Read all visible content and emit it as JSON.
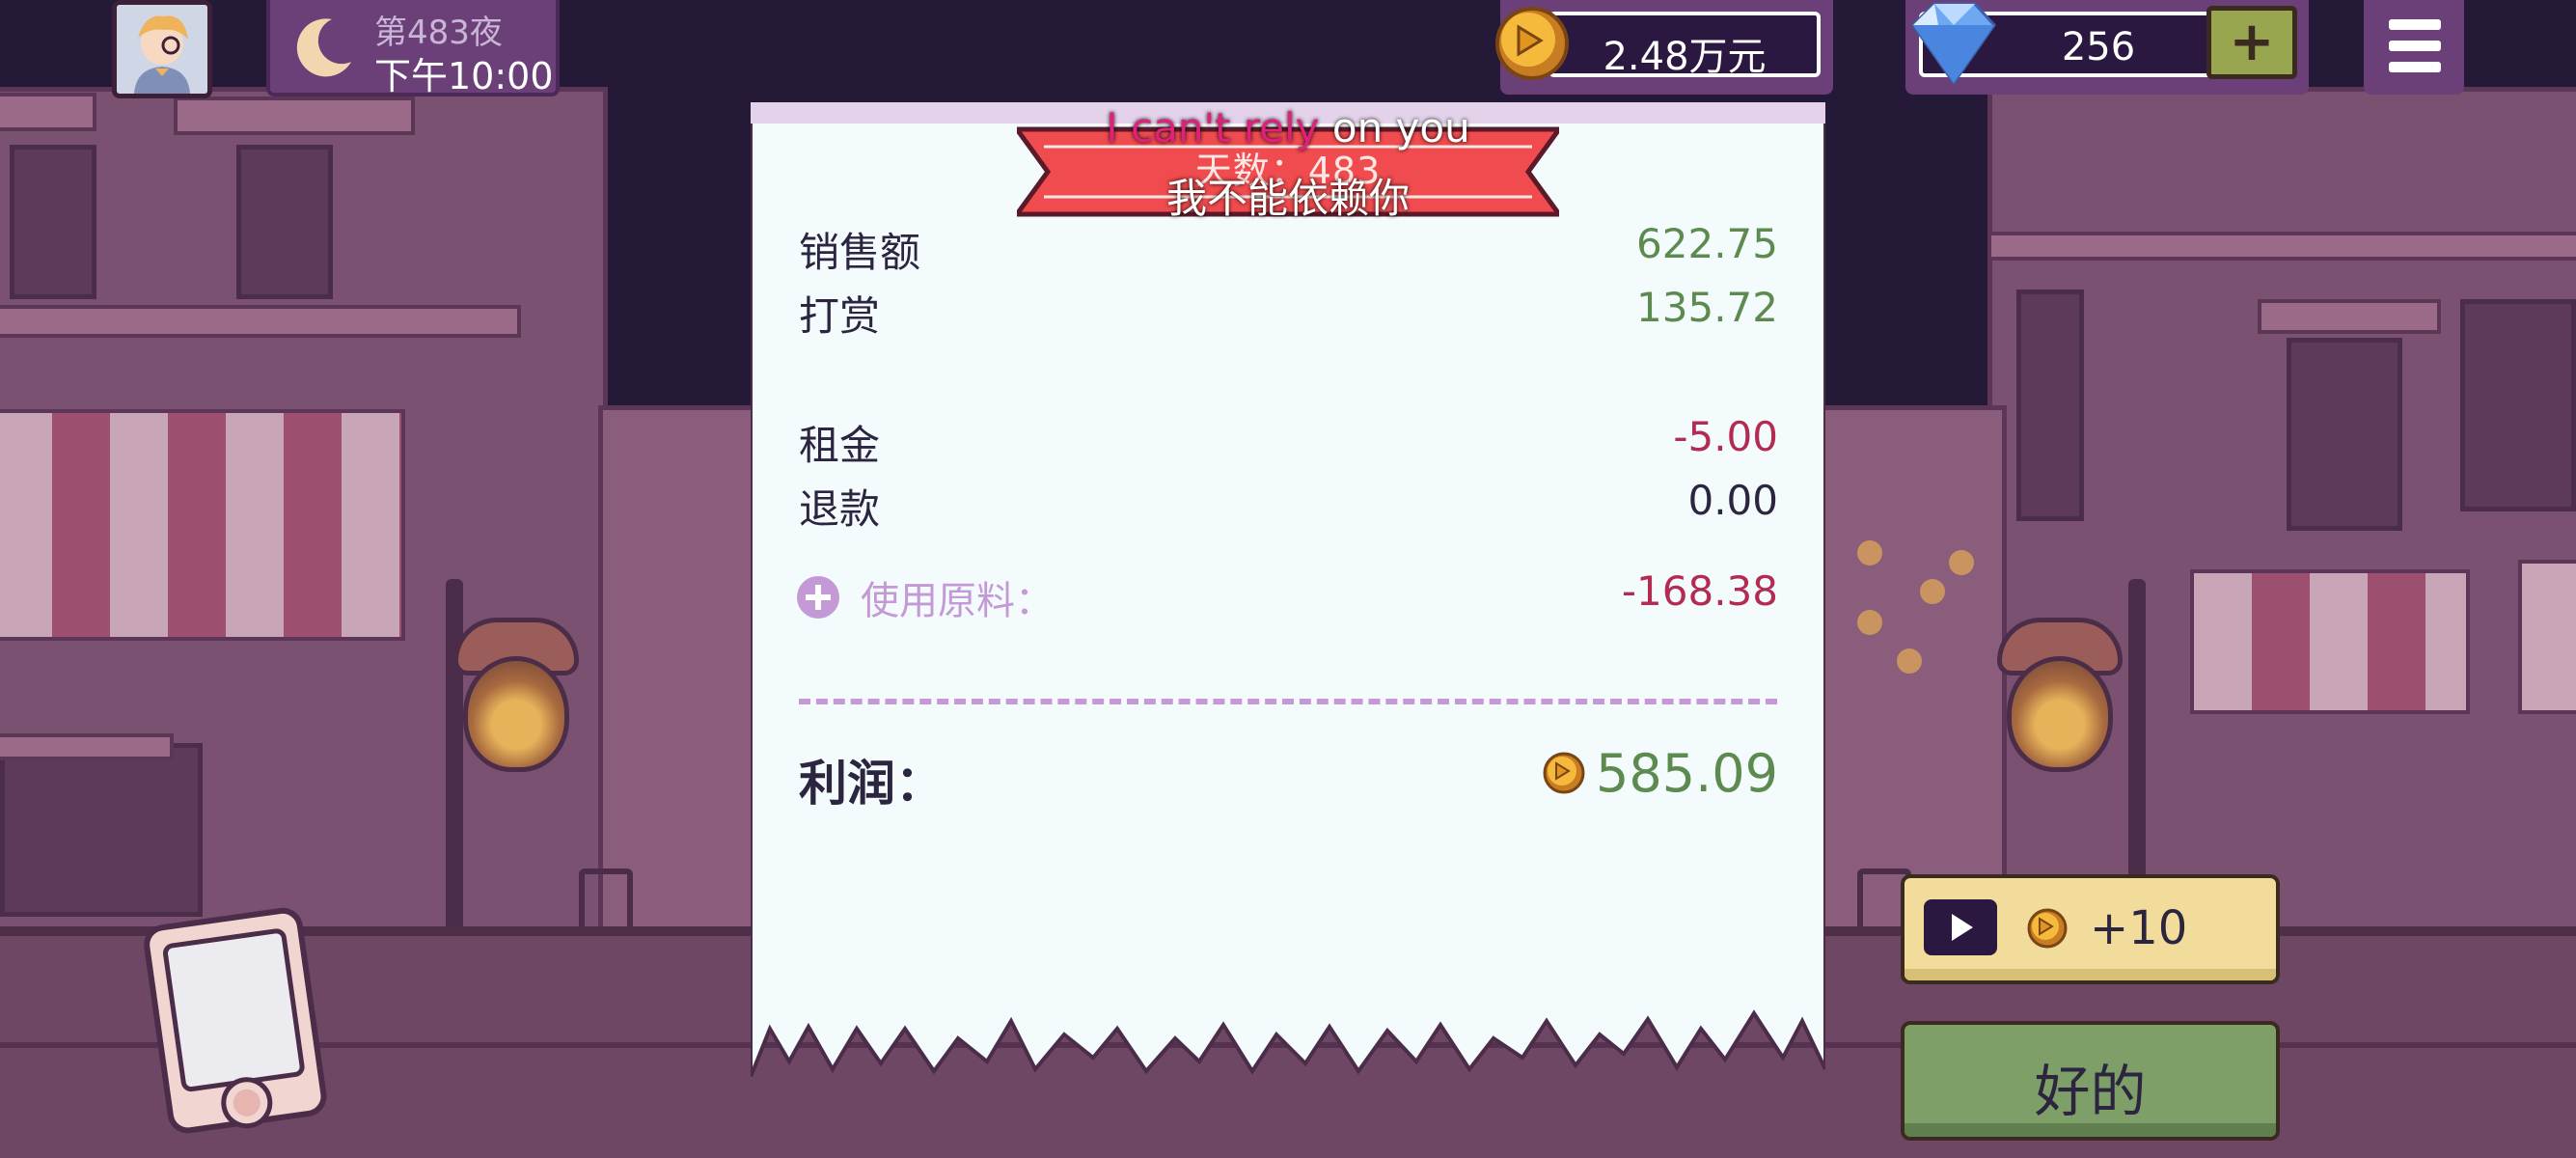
{
  "hud": {
    "day_label": "第483夜",
    "time_label": "下午10:00",
    "money": "2.48万元",
    "gems": "256",
    "gem_plus_label": "+"
  },
  "receipt": {
    "banner_title": "天数：483",
    "rows": [
      {
        "label": "销售额",
        "value": "622.75"
      },
      {
        "label": "打赏",
        "value": "135.72"
      },
      {
        "label": "租金",
        "value": "-5.00"
      },
      {
        "label": "退款",
        "value": "0.00"
      }
    ],
    "ingredients_label": "使用原料：",
    "ingredients_value": "-168.38",
    "profit_label": "利润：",
    "profit_value": "585.09"
  },
  "subtitles": {
    "en_highlight": "I can't rely",
    "en_rest": " on you",
    "zh": "我不能依赖你"
  },
  "buttons": {
    "ad_reward": "+10",
    "ok": "好的"
  },
  "colors": {
    "positive": "#5c8a4f",
    "negative": "#b32b52",
    "accent_purple": "#6b3f78",
    "ingredient": "#c49ad6",
    "banner_red": "#f04b4e"
  },
  "icons": [
    "avatar",
    "moon-icon",
    "coin-icon",
    "diamond-icon",
    "plus-icon",
    "menu-icon",
    "plus-circle-icon",
    "play-icon",
    "tablet-icon"
  ]
}
